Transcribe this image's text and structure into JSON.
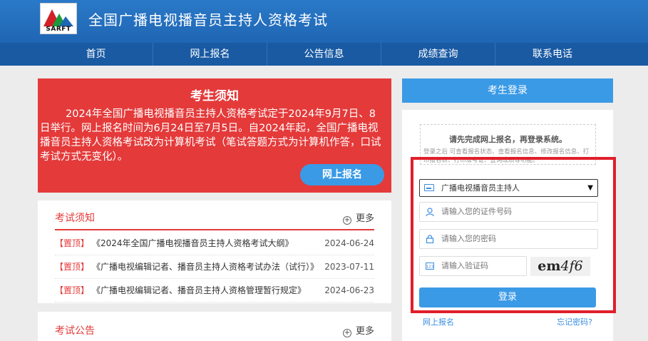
{
  "header": {
    "logo_text": "SARFT",
    "title": "全国广播电视播音员主持人资格考试"
  },
  "nav": [
    "首页",
    "网上报名",
    "公告信息",
    "成绩查询",
    "联系电话"
  ],
  "notice": {
    "title": "考生须知",
    "body": "2024年全国广播电视播音员主持人资格考试定于2024年9月7日、8日举行。网上报名时间为6月24日至7月5日。自2024年起，全国广播电视播音员主持人资格考试改为计算机考试（笔试答题方式为计算机作答，口试考试方式无变化）。",
    "button": "网上报名"
  },
  "exam_notes": {
    "title": "考试须知",
    "more": "更多",
    "rows": [
      {
        "tag": "【置顶】",
        "title": "《2024年全国广播电视播音员主持人资格考试大纲》",
        "date": "2024-06-24"
      },
      {
        "tag": "【置顶】",
        "title": "《广播电视编辑记者、播音员主持人资格考试办法（试行）》",
        "date": "2023-07-11"
      },
      {
        "tag": "【置顶】",
        "title": "《广播电视编辑记者、播音员主持人资格管理暂行规定》",
        "date": "2024-06-23"
      }
    ]
  },
  "announcements": {
    "title": "考试公告",
    "more": "更多"
  },
  "login": {
    "header": "考生登录",
    "hint_title": "请先完成网上报名，再登录系统。",
    "hint_text": "登录之后 可查看报名状态、查看报名信息、修改报名信息、打印报名表、打印准考证、查询成绩等功能。",
    "exam_type": "广播电视播音员主持人",
    "id_placeholder": "请输入您的证件号码",
    "password_placeholder": "请输入您的密码",
    "captcha_placeholder": "请输入验证码",
    "captcha_a": "em",
    "captcha_b": "4f6",
    "submit": "登录",
    "register_link": "网上报名",
    "forgot_link": "忘记密码?"
  },
  "colors": {
    "header_blue": "#1f66b4",
    "nav_blue": "#1a5aa3",
    "notice_red": "#e43a3a",
    "accent_blue": "#3a9ae6",
    "highlight_red": "#e11e2b"
  }
}
